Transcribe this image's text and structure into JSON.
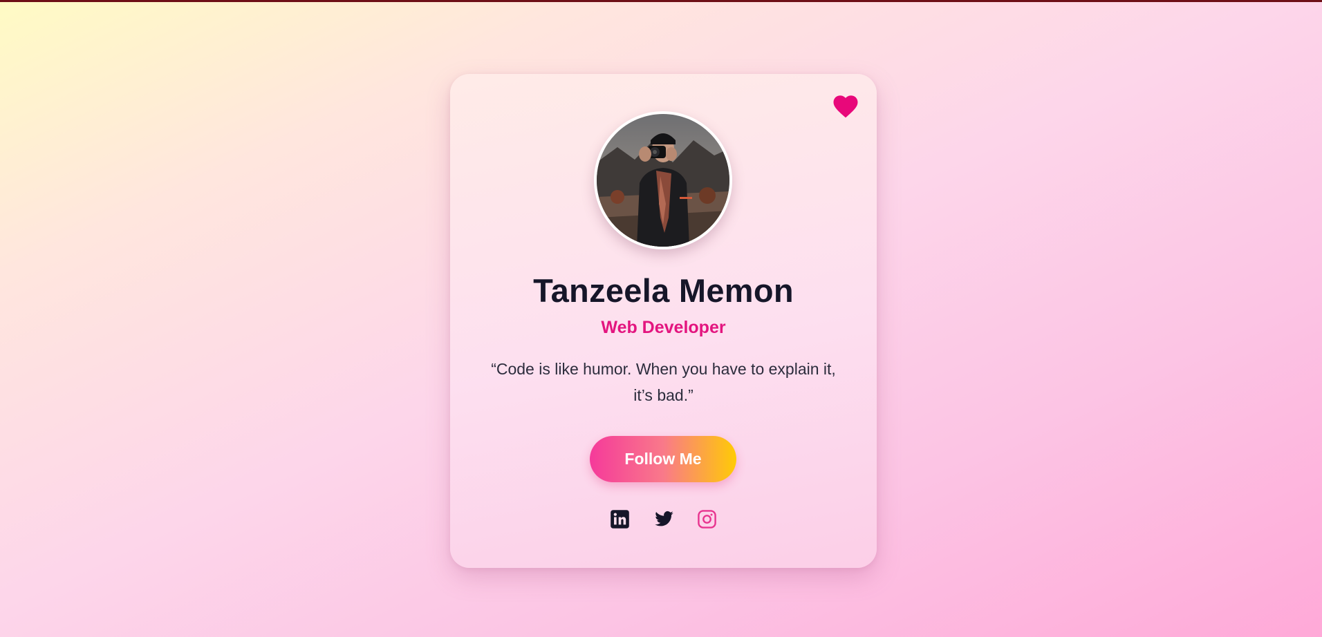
{
  "profile": {
    "name": "Tanzeela Memon",
    "role": "Web Developer",
    "quote": "“Code is like humor. When you have to explain it, it’s bad.”",
    "avatar_icon": "profile-photo"
  },
  "actions": {
    "follow_label": "Follow Me",
    "like_icon": "heart-icon"
  },
  "social_links": [
    {
      "icon": "linkedin-icon",
      "label": "LinkedIn"
    },
    {
      "icon": "twitter-icon",
      "label": "Twitter"
    },
    {
      "icon": "instagram-icon",
      "label": "Instagram"
    }
  ],
  "colors": {
    "accent": "#e3157f",
    "name_text": "#161629",
    "button_gradient_start": "#f53a9a",
    "button_gradient_end": "#ffcb05",
    "heart": "#e8087a"
  }
}
